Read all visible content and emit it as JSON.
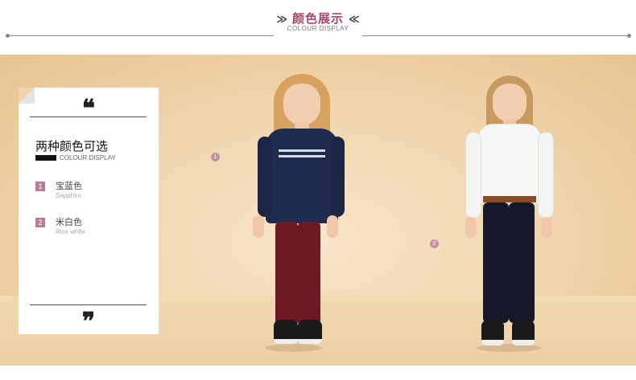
{
  "header": {
    "title": "颜色展示",
    "subtitle": "COLOUR DISPLAY",
    "arrow_left": "≫",
    "arrow_right": "≪"
  },
  "card": {
    "quote_open": "❝",
    "quote_close": "❞",
    "heading": "两种颜色可选",
    "subheading": "COLOUR DISPLAY",
    "options": [
      {
        "num": "1",
        "name_cn": "宝蓝色",
        "name_en": "Sapphire"
      },
      {
        "num": "2",
        "name_cn": "米白色",
        "name_en": "Rice white"
      }
    ]
  },
  "markers": [
    {
      "num": "1"
    },
    {
      "num": "2"
    }
  ],
  "colors": {
    "accent": "#a5466b",
    "number_badge": "#b97b92",
    "marker": "#c790a5",
    "background": "#f0d4ab",
    "sapphire_blouse": "#1f2a4f",
    "burgundy_pants": "#6e1a24",
    "white_blouse": "#f7f7f5",
    "navy_pants": "#141829"
  }
}
